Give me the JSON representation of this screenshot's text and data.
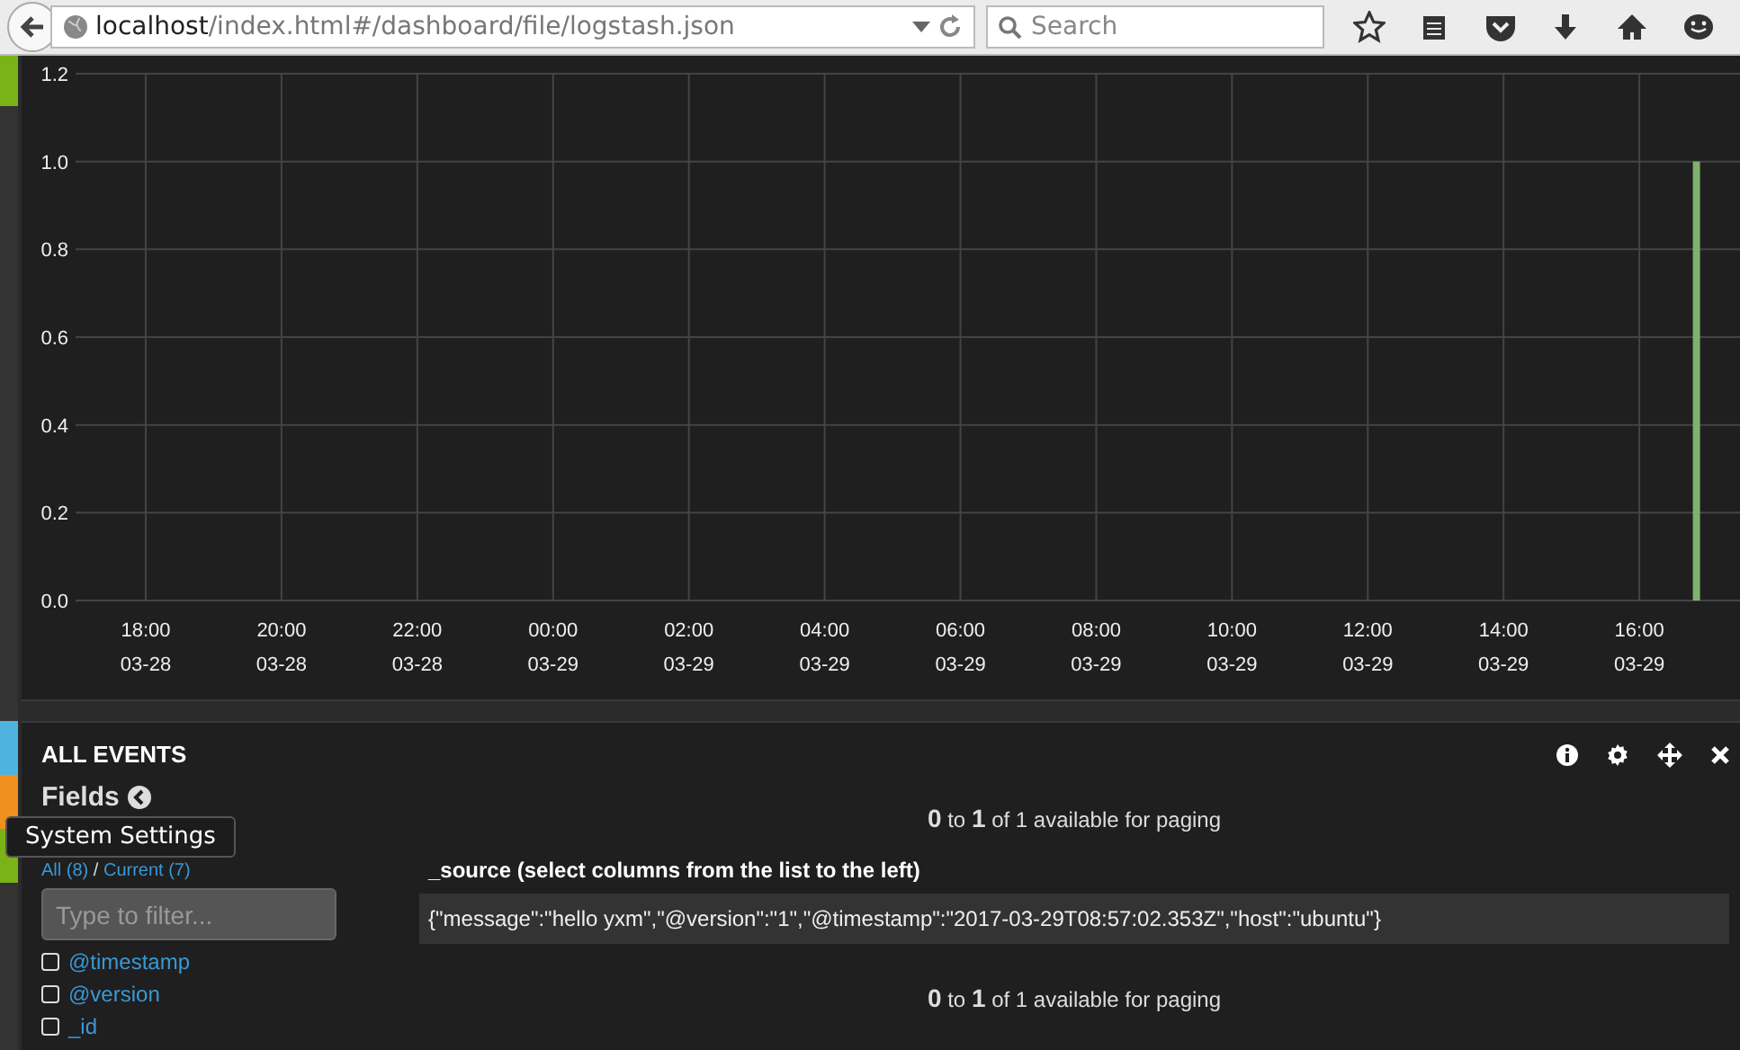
{
  "browser": {
    "url_host": "localhost",
    "url_path": "/index.html#/dashboard/file/logstash.json",
    "search_placeholder": "Search"
  },
  "side_tabs_top": [
    {
      "color": "#7ab317"
    }
  ],
  "side_tabs_bottom": [
    {
      "color": "#4fb3e0"
    },
    {
      "color": "#f0901e"
    },
    {
      "color": "#7ab317"
    }
  ],
  "histogram": {
    "chart_data": {
      "type": "bar",
      "categories": [
        null,
        "18:00 03-28",
        null,
        "20:00 03-28",
        null,
        "22:00 03-28",
        null,
        "00:00 03-29",
        null,
        "02:00 03-29",
        null,
        "04:00 03-29",
        null,
        "06:00 03-29",
        null,
        "08:00 03-29",
        null,
        "10:00 03-29",
        null,
        "12:00 03-29",
        null,
        "14:00 03-29",
        null,
        "16:00 03-29",
        null
      ],
      "series": [
        {
          "color": "#7eb26d",
          "values": [
            null,
            null,
            null,
            null,
            null,
            null,
            null,
            null,
            null,
            null,
            null,
            null,
            null,
            null,
            null,
            null,
            null,
            null,
            null,
            null,
            null,
            null,
            null,
            null,
            1
          ]
        }
      ],
      "ylim": [
        0,
        1.2
      ],
      "grid": true,
      "yticks": [
        {
          "value": 0,
          "label": "0.0"
        },
        {
          "value": 0.2,
          "label": "0.2"
        },
        {
          "value": 0.4,
          "label": "0.4"
        },
        {
          "value": 0.6,
          "label": "0.6"
        },
        {
          "value": 0.8,
          "label": "0.8"
        },
        {
          "value": 1,
          "label": "1.0"
        },
        {
          "value": 1.2,
          "label": "1.2"
        }
      ]
    }
  },
  "events": {
    "title": "ALL EVENTS",
    "fields_title": "Fields",
    "all_label": "All (8)",
    "separator": "/",
    "current_label": "Current (7)",
    "filter_placeholder": "Type to filter...",
    "fields": [
      {
        "name": "@timestamp",
        "checked": false
      },
      {
        "name": "@version",
        "checked": false
      },
      {
        "name": "_id",
        "checked": false
      }
    ],
    "paging_top": "**0** to **1** of 1 available for paging",
    "column_header": "_source (select columns from the list to the left)",
    "rows": [
      "{\"message\":\"hello yxm\",\"@version\":\"1\",\"@timestamp\":\"2017-03-29T08:57:02.353Z\",\"host\":\"ubuntu\"}"
    ],
    "paging_bottom": "**0** to **1** of 1 available for paging"
  },
  "tooltip": {
    "text": "System Settings"
  }
}
